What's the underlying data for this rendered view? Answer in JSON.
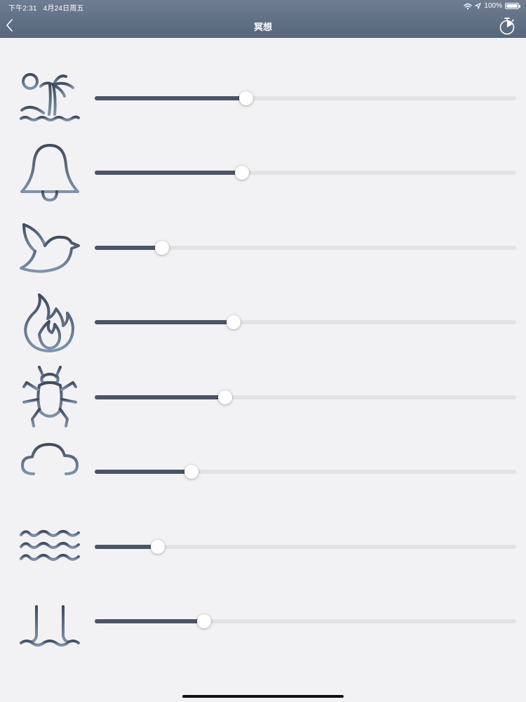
{
  "status_bar": {
    "time": "下午2:31",
    "date": "4月24日周五",
    "battery": "100%"
  },
  "nav": {
    "title": "冥想"
  },
  "sounds": [
    {
      "icon": "beach-palm-icon",
      "level": 0.36
    },
    {
      "icon": "bell-icon",
      "level": 0.35
    },
    {
      "icon": "dove-icon",
      "level": 0.16
    },
    {
      "icon": "fire-icon",
      "level": 0.33
    },
    {
      "icon": "insect-icon",
      "level": 0.31
    },
    {
      "icon": "rain-cloud-icon",
      "level": 0.23
    },
    {
      "icon": "waves-icon",
      "level": 0.15
    },
    {
      "icon": "waterfall-icon",
      "level": 0.26
    }
  ],
  "colors": {
    "nav_bar": "#5e6e83",
    "slider_fill": "#4a5465",
    "slider_track": "#e3e3e6",
    "icon_gradient_top": "#3f4a5c",
    "icon_gradient_bottom": "#7d93ad"
  }
}
